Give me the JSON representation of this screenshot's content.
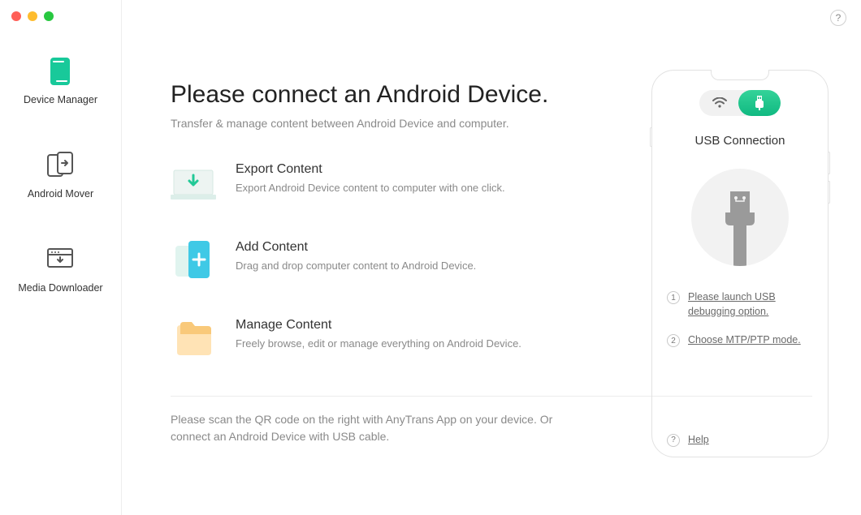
{
  "sidebar": {
    "items": [
      {
        "label": "Device Manager"
      },
      {
        "label": "Android Mover"
      },
      {
        "label": "Media Downloader"
      }
    ]
  },
  "main": {
    "title": "Please connect an Android Device.",
    "subtitle": "Transfer & manage content between Android Device and computer.",
    "features": [
      {
        "title": "Export Content",
        "desc": "Export Android Device content to computer with one click."
      },
      {
        "title": "Add Content",
        "desc": "Drag and drop computer content to Android Device."
      },
      {
        "title": "Manage Content",
        "desc": "Freely browse, edit or manage everything on Android Device."
      }
    ],
    "footer": "Please scan the QR code on the right with AnyTrans App on your device. Or connect an Android Device with USB cable."
  },
  "device": {
    "title": "USB Connection",
    "steps": [
      {
        "num": "1",
        "text": "Please launch USB debugging option."
      },
      {
        "num": "2",
        "text": "Choose MTP/PTP mode."
      }
    ],
    "help": {
      "num": "?",
      "text": "Help"
    }
  },
  "help_button": "?"
}
